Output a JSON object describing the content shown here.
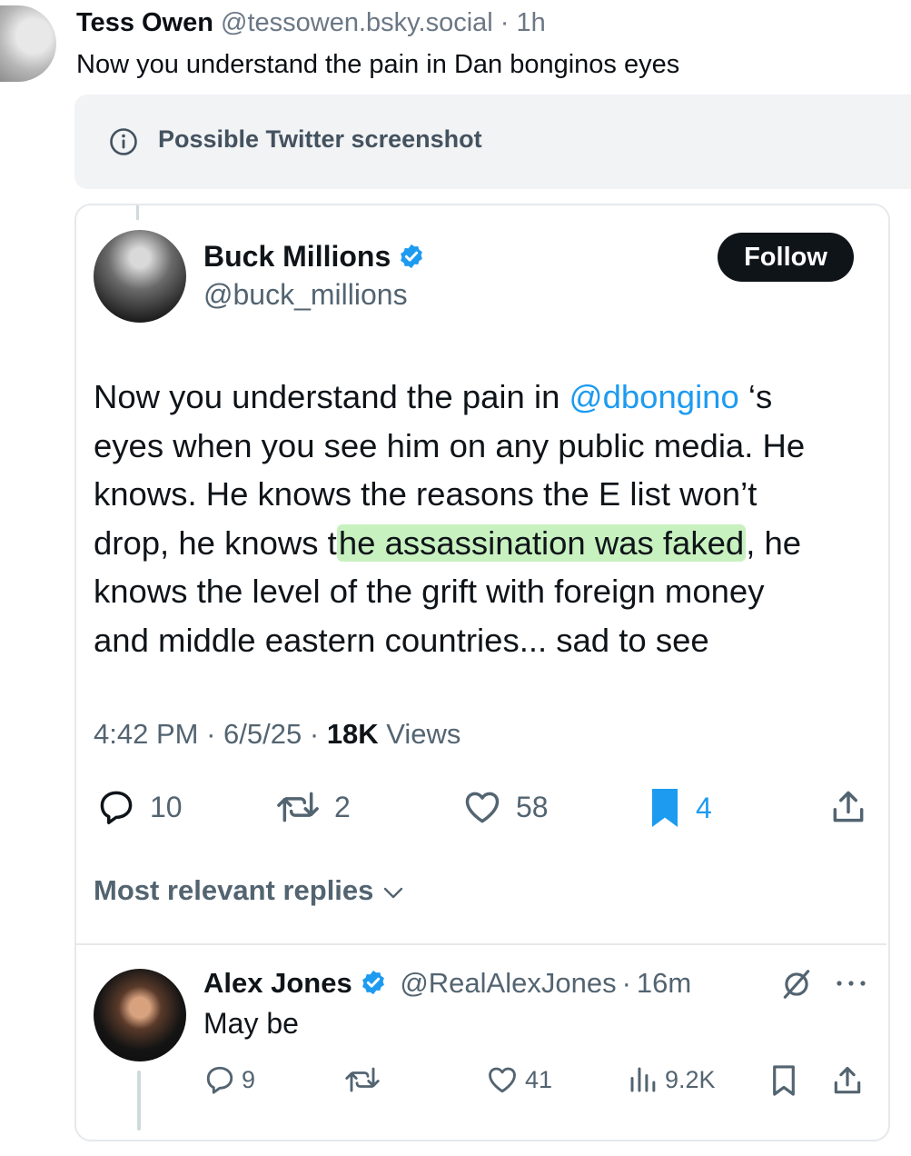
{
  "bsky_post": {
    "author_name": "Tess Owen",
    "author_handle": "@tessowen.bsky.social",
    "separator": "·",
    "time": "1h",
    "text": "Now you understand the pain in Dan bonginos eyes",
    "warning": {
      "icon": "info-icon",
      "label": "Possible Twitter screenshot"
    }
  },
  "tweet": {
    "author_name": "Buck Millions",
    "author_handle": "@buck_millions",
    "follow_label": "Follow",
    "body": {
      "l1_a": "Now you understand the pain in ",
      "l1_mention": "@dbongino",
      "l1_b": " ‘s",
      "l2": "eyes when you see him on any public media. He",
      "l3": "knows. He knows the reasons the E list won’t",
      "l4_a": "drop, he knows t",
      "l4_highlight": "he assassination was faked",
      "l4_b": ", he",
      "l5": "knows the level of the grift with foreign money",
      "l6": "and middle eastern countries... sad to see"
    },
    "time": "4:42 PM",
    "date": "6/5/25",
    "separator": "·",
    "views_count": "18K",
    "views_label": " Views",
    "stats": {
      "replies": "10",
      "reposts": "2",
      "likes": "58",
      "bookmarks": "4"
    },
    "colors": {
      "bookmark_active": "#1d9bf0",
      "highlight": "#c8f1c0",
      "mention": "#1d9bf0"
    }
  },
  "replies_header": "Most relevant replies",
  "reply": {
    "author_name": "Alex Jones",
    "author_handle": "@RealAlexJones",
    "separator": "·",
    "time": "16m",
    "text": "May be",
    "stats": {
      "replies": "9",
      "likes": "41",
      "views": "9.2K"
    }
  }
}
